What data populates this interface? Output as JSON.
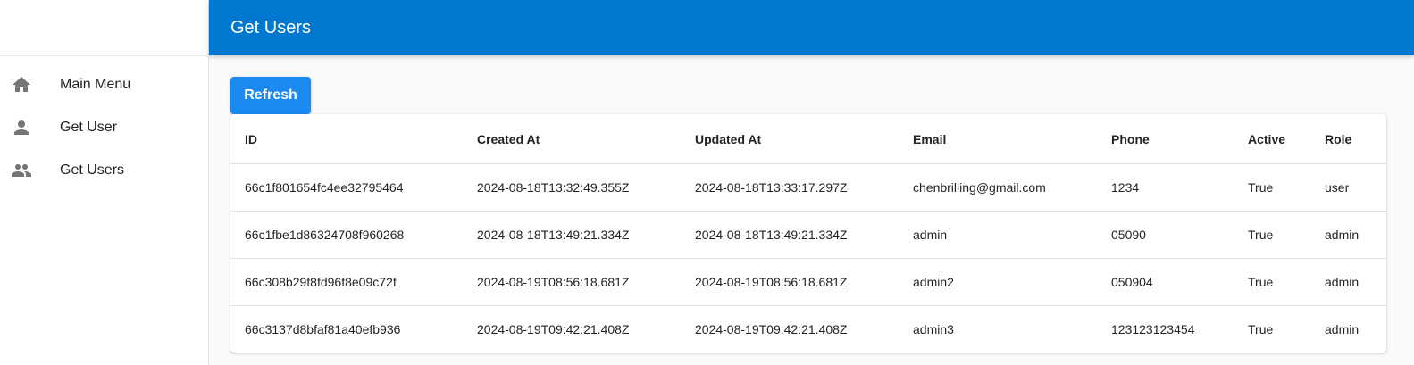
{
  "appbar": {
    "title": "Get Users"
  },
  "sidebar": {
    "items": [
      {
        "label": "Main Menu",
        "icon": "home-icon"
      },
      {
        "label": "Get User",
        "icon": "person-icon"
      },
      {
        "label": "Get Users",
        "icon": "people-icon"
      }
    ]
  },
  "toolbar": {
    "refresh_label": "Refresh"
  },
  "colors": {
    "appbar": "#0078d0",
    "button": "#1a8af0"
  },
  "table": {
    "columns": [
      "ID",
      "Created At",
      "Updated At",
      "Email",
      "Phone",
      "Active",
      "Role"
    ],
    "rows": [
      [
        "66c1f801654fc4ee32795464",
        "2024-08-18T13:32:49.355Z",
        "2024-08-18T13:33:17.297Z",
        "chenbrilling@gmail.com",
        "1234",
        "True",
        "user"
      ],
      [
        "66c1fbe1d86324708f960268",
        "2024-08-18T13:49:21.334Z",
        "2024-08-18T13:49:21.334Z",
        "admin",
        "05090",
        "True",
        "admin"
      ],
      [
        "66c308b29f8fd96f8e09c72f",
        "2024-08-19T08:56:18.681Z",
        "2024-08-19T08:56:18.681Z",
        "admin2",
        "050904",
        "True",
        "admin"
      ],
      [
        "66c3137d8bfaf81a40efb936",
        "2024-08-19T09:42:21.408Z",
        "2024-08-19T09:42:21.408Z",
        "admin3",
        "123123123454",
        "True",
        "admin"
      ]
    ]
  }
}
